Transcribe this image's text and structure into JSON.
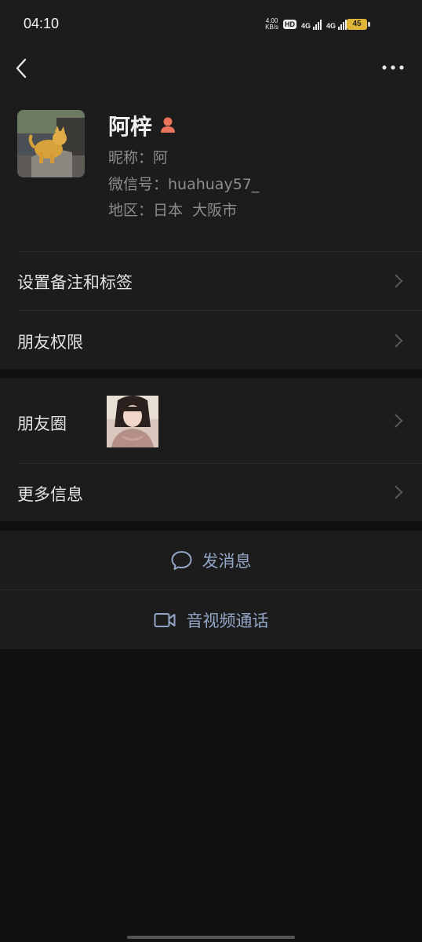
{
  "status_bar": {
    "time": "04:10",
    "net_speed_value": "4.00",
    "net_speed_unit": "KB/s",
    "hd_label": "HD",
    "sim1_label": "4G",
    "sim2_label": "4G",
    "battery": "45"
  },
  "profile": {
    "remark_name": "阿梓",
    "nickname": "昵称：阿",
    "wechat_id": "微信号：huahuay57_",
    "region": "地区：日本  大阪市"
  },
  "settings": {
    "remark_tags": "设置备注和标签",
    "friend_permissions": "朋友权限"
  },
  "info": {
    "moments": "朋友圈",
    "more_info": "更多信息"
  },
  "actions": {
    "send_message": "发消息",
    "av_call": "音视频通话"
  },
  "colors": {
    "background": "#111111",
    "card": "#1c1c1c",
    "action_text": "#93a6c6",
    "contact_icon": "#e8735a"
  }
}
